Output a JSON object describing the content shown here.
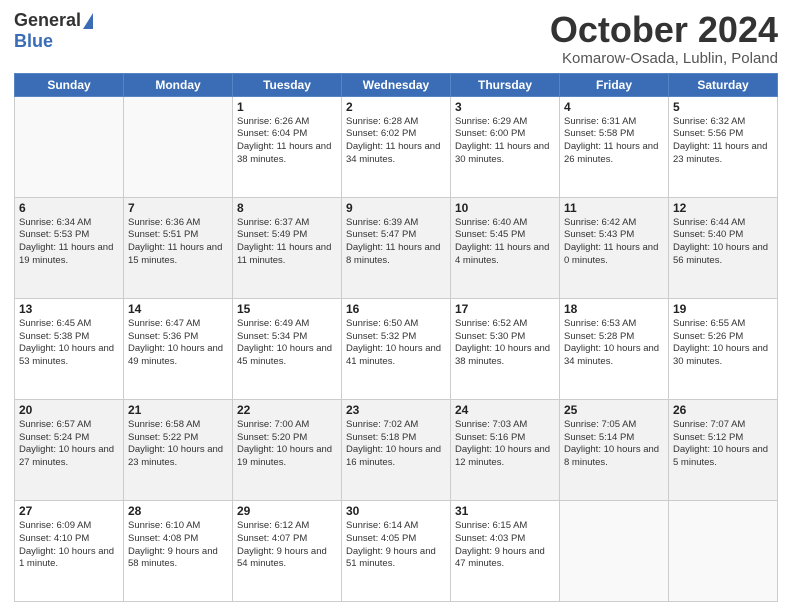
{
  "header": {
    "logo_general": "General",
    "logo_blue": "Blue",
    "month_title": "October 2024",
    "location": "Komarow-Osada, Lublin, Poland"
  },
  "days_of_week": [
    "Sunday",
    "Monday",
    "Tuesday",
    "Wednesday",
    "Thursday",
    "Friday",
    "Saturday"
  ],
  "weeks": [
    [
      {
        "day": "",
        "info": ""
      },
      {
        "day": "",
        "info": ""
      },
      {
        "day": "1",
        "info": "Sunrise: 6:26 AM\nSunset: 6:04 PM\nDaylight: 11 hours and 38 minutes."
      },
      {
        "day": "2",
        "info": "Sunrise: 6:28 AM\nSunset: 6:02 PM\nDaylight: 11 hours and 34 minutes."
      },
      {
        "day": "3",
        "info": "Sunrise: 6:29 AM\nSunset: 6:00 PM\nDaylight: 11 hours and 30 minutes."
      },
      {
        "day": "4",
        "info": "Sunrise: 6:31 AM\nSunset: 5:58 PM\nDaylight: 11 hours and 26 minutes."
      },
      {
        "day": "5",
        "info": "Sunrise: 6:32 AM\nSunset: 5:56 PM\nDaylight: 11 hours and 23 minutes."
      }
    ],
    [
      {
        "day": "6",
        "info": "Sunrise: 6:34 AM\nSunset: 5:53 PM\nDaylight: 11 hours and 19 minutes."
      },
      {
        "day": "7",
        "info": "Sunrise: 6:36 AM\nSunset: 5:51 PM\nDaylight: 11 hours and 15 minutes."
      },
      {
        "day": "8",
        "info": "Sunrise: 6:37 AM\nSunset: 5:49 PM\nDaylight: 11 hours and 11 minutes."
      },
      {
        "day": "9",
        "info": "Sunrise: 6:39 AM\nSunset: 5:47 PM\nDaylight: 11 hours and 8 minutes."
      },
      {
        "day": "10",
        "info": "Sunrise: 6:40 AM\nSunset: 5:45 PM\nDaylight: 11 hours and 4 minutes."
      },
      {
        "day": "11",
        "info": "Sunrise: 6:42 AM\nSunset: 5:43 PM\nDaylight: 11 hours and 0 minutes."
      },
      {
        "day": "12",
        "info": "Sunrise: 6:44 AM\nSunset: 5:40 PM\nDaylight: 10 hours and 56 minutes."
      }
    ],
    [
      {
        "day": "13",
        "info": "Sunrise: 6:45 AM\nSunset: 5:38 PM\nDaylight: 10 hours and 53 minutes."
      },
      {
        "day": "14",
        "info": "Sunrise: 6:47 AM\nSunset: 5:36 PM\nDaylight: 10 hours and 49 minutes."
      },
      {
        "day": "15",
        "info": "Sunrise: 6:49 AM\nSunset: 5:34 PM\nDaylight: 10 hours and 45 minutes."
      },
      {
        "day": "16",
        "info": "Sunrise: 6:50 AM\nSunset: 5:32 PM\nDaylight: 10 hours and 41 minutes."
      },
      {
        "day": "17",
        "info": "Sunrise: 6:52 AM\nSunset: 5:30 PM\nDaylight: 10 hours and 38 minutes."
      },
      {
        "day": "18",
        "info": "Sunrise: 6:53 AM\nSunset: 5:28 PM\nDaylight: 10 hours and 34 minutes."
      },
      {
        "day": "19",
        "info": "Sunrise: 6:55 AM\nSunset: 5:26 PM\nDaylight: 10 hours and 30 minutes."
      }
    ],
    [
      {
        "day": "20",
        "info": "Sunrise: 6:57 AM\nSunset: 5:24 PM\nDaylight: 10 hours and 27 minutes."
      },
      {
        "day": "21",
        "info": "Sunrise: 6:58 AM\nSunset: 5:22 PM\nDaylight: 10 hours and 23 minutes."
      },
      {
        "day": "22",
        "info": "Sunrise: 7:00 AM\nSunset: 5:20 PM\nDaylight: 10 hours and 19 minutes."
      },
      {
        "day": "23",
        "info": "Sunrise: 7:02 AM\nSunset: 5:18 PM\nDaylight: 10 hours and 16 minutes."
      },
      {
        "day": "24",
        "info": "Sunrise: 7:03 AM\nSunset: 5:16 PM\nDaylight: 10 hours and 12 minutes."
      },
      {
        "day": "25",
        "info": "Sunrise: 7:05 AM\nSunset: 5:14 PM\nDaylight: 10 hours and 8 minutes."
      },
      {
        "day": "26",
        "info": "Sunrise: 7:07 AM\nSunset: 5:12 PM\nDaylight: 10 hours and 5 minutes."
      }
    ],
    [
      {
        "day": "27",
        "info": "Sunrise: 6:09 AM\nSunset: 4:10 PM\nDaylight: 10 hours and 1 minute."
      },
      {
        "day": "28",
        "info": "Sunrise: 6:10 AM\nSunset: 4:08 PM\nDaylight: 9 hours and 58 minutes."
      },
      {
        "day": "29",
        "info": "Sunrise: 6:12 AM\nSunset: 4:07 PM\nDaylight: 9 hours and 54 minutes."
      },
      {
        "day": "30",
        "info": "Sunrise: 6:14 AM\nSunset: 4:05 PM\nDaylight: 9 hours and 51 minutes."
      },
      {
        "day": "31",
        "info": "Sunrise: 6:15 AM\nSunset: 4:03 PM\nDaylight: 9 hours and 47 minutes."
      },
      {
        "day": "",
        "info": ""
      },
      {
        "day": "",
        "info": ""
      }
    ]
  ]
}
